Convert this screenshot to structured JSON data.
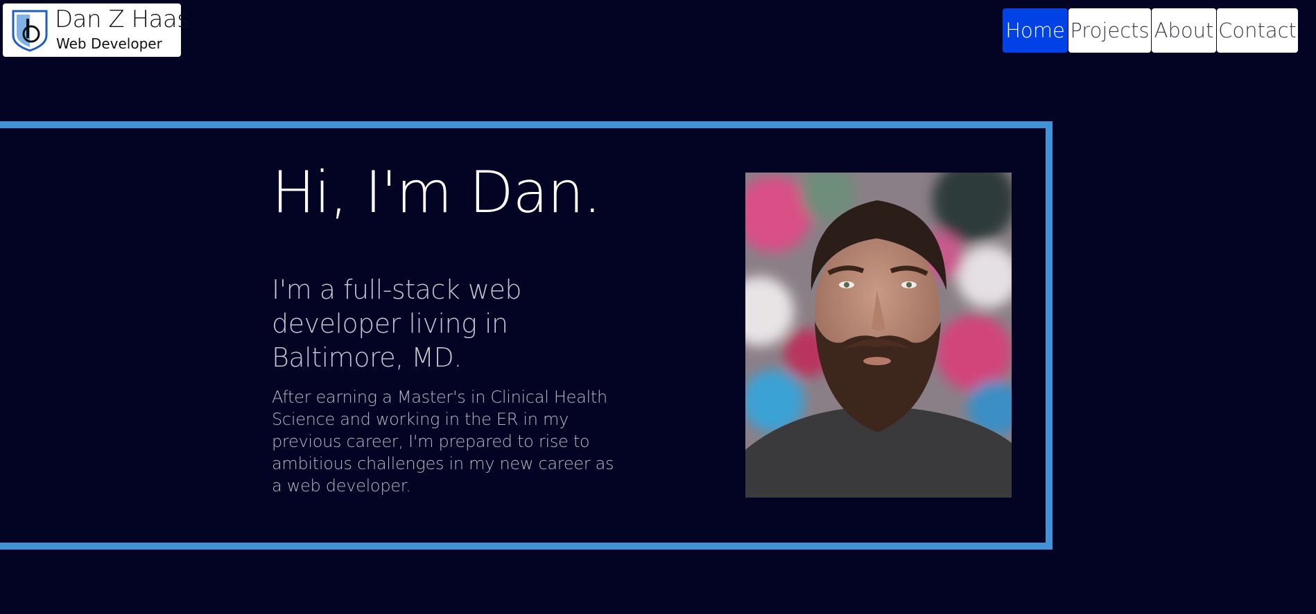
{
  "logo": {
    "name": "Dan Z Haas",
    "tagline": "Web Developer",
    "icon": "shield-logo-icon",
    "colors": {
      "shield": "#1f5fc2",
      "shield_light": "#7fb3e8"
    }
  },
  "nav": {
    "items": [
      {
        "label": "Home",
        "active": true
      },
      {
        "label": "Projects",
        "active": false
      },
      {
        "label": "About",
        "active": false
      },
      {
        "label": "Contact",
        "active": false
      }
    ]
  },
  "hero": {
    "heading": "Hi, I'm Dan.",
    "subtitle": "I'm a full-stack web developer living in Baltimore, MD.",
    "body": "After earning a Master's in Clinical Health Science and working in the ER in my previous career, I'm prepared to rise to ambitious challenges in my new career as a web developer.",
    "portrait": "portrait-photo"
  },
  "colors": {
    "background": "#030323",
    "accent_border": "#4193d8",
    "nav_active": "#0042e6",
    "nav_inactive": "#ffffff",
    "heading_text": "#ffffff",
    "body_text": "#b9b9c6"
  }
}
